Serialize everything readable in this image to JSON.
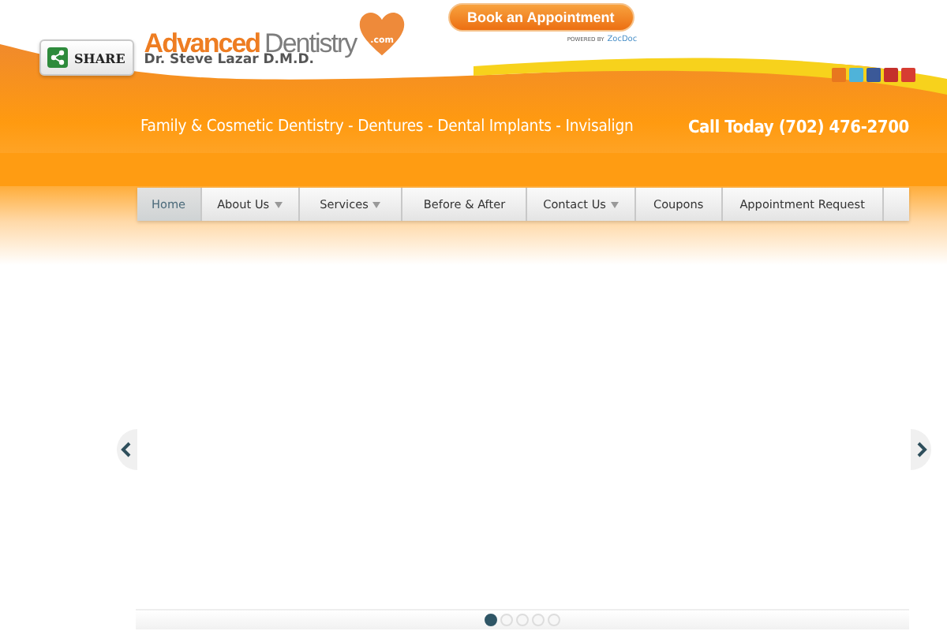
{
  "share_button": {
    "label": "SHARE"
  },
  "logo": {
    "word_1": "Advanced",
    "word_2": "Dentistry",
    "domain": ".com",
    "subtitle": "Dr. Steve Lazar D.M.D."
  },
  "booking": {
    "button": "Book an Appointment",
    "powered_by": "POWERED BY",
    "provider": "ZocDoc"
  },
  "tagline": "Family & Cosmetic Dentistry - Dentures - Dental Implants - Invisalign",
  "phone": "Call Today (702) 476-2700",
  "nav": [
    {
      "label": "Home",
      "selected": true,
      "has_menu": false
    },
    {
      "label": "About Us",
      "selected": false,
      "has_menu": true
    },
    {
      "label": "Services",
      "selected": false,
      "has_menu": true
    },
    {
      "label": "Before & After",
      "selected": false,
      "has_menu": false
    },
    {
      "label": "Contact Us",
      "selected": false,
      "has_menu": true
    },
    {
      "label": "Coupons",
      "selected": false,
      "has_menu": false
    },
    {
      "label": "Appointment Request",
      "selected": false,
      "has_menu": false
    }
  ],
  "slider": {
    "dots": [
      {
        "selected": true
      },
      {
        "selected": false
      },
      {
        "selected": false
      },
      {
        "selected": false
      },
      {
        "selected": false
      }
    ]
  }
}
